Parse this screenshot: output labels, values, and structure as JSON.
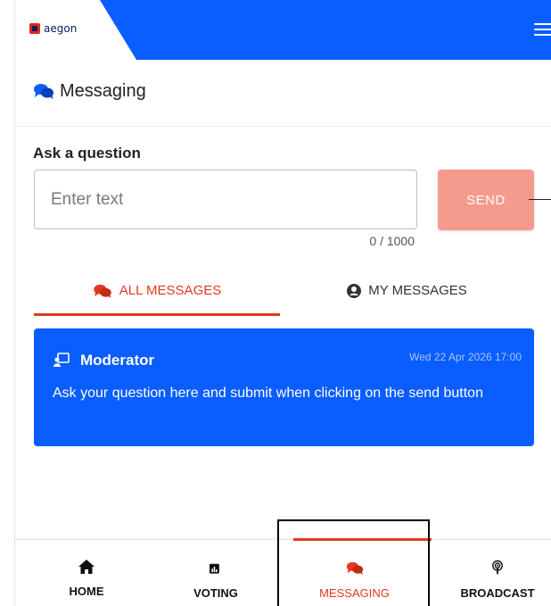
{
  "header": {
    "logo_text": "aegon",
    "menu_icon": "hamburger-icon",
    "brand_color": "#0a5dff"
  },
  "page": {
    "title": "Messaging",
    "title_icon": "chat-bubbles-icon"
  },
  "ask": {
    "label": "Ask a question",
    "input_value": "",
    "placeholder": "Enter text",
    "counter": "0 / 1000",
    "send_label": "SEND",
    "send_color": "#f59b8d"
  },
  "tabs": [
    {
      "label": "ALL MESSAGES",
      "icon": "chat-bubbles-icon",
      "active": true
    },
    {
      "label": "MY MESSAGES",
      "icon": "user-circle-icon",
      "active": false
    }
  ],
  "messages": [
    {
      "author": "Moderator",
      "icon": "presenter-icon",
      "timestamp": "Wed 22 Apr 2026 17:00",
      "text": "Ask your question here and submit when clicking on the send button"
    }
  ],
  "bottom_nav": [
    {
      "label": "HOME",
      "icon": "home-icon",
      "active": false
    },
    {
      "label": "VOTING",
      "icon": "poll-icon",
      "active": false
    },
    {
      "label": "MESSAGING",
      "icon": "chat-bubbles-icon",
      "active": true
    },
    {
      "label": "BROADCAST",
      "icon": "broadcast-icon",
      "active": false
    }
  ],
  "colors": {
    "accent": "#e2381f",
    "card": "#0a5dff"
  }
}
